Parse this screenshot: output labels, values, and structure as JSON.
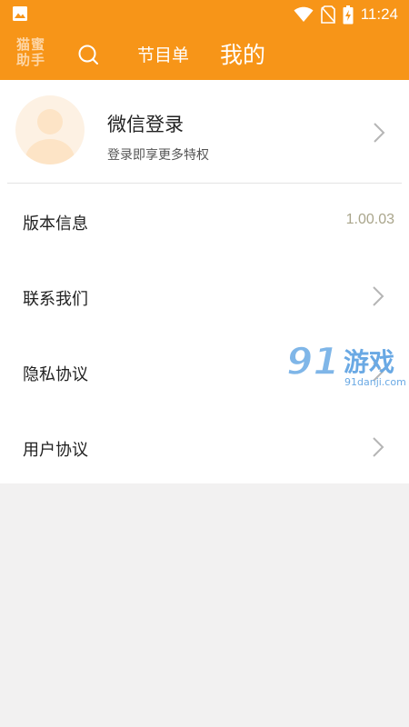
{
  "status_bar": {
    "time": "11:24",
    "icons": [
      "image-notification-icon",
      "wifi-icon",
      "no-sim-icon",
      "battery-charging-icon"
    ]
  },
  "app_bar": {
    "logo_text": [
      "猫蜜",
      "助手"
    ],
    "search_icon": "search-icon",
    "tabs": [
      {
        "label": "节目单",
        "selected": false
      },
      {
        "label": "我的",
        "selected": true
      }
    ]
  },
  "profile": {
    "name": "微信登录",
    "subtitle": "登录即享更多特权",
    "avatar_icon": "user-avatar-icon"
  },
  "menu": {
    "items": [
      {
        "label": "版本信息",
        "value": "1.00.03"
      },
      {
        "label": "联系我们"
      },
      {
        "label": "隐私协议"
      },
      {
        "label": "用户协议"
      }
    ]
  },
  "watermark": {
    "brand": "91游戏",
    "domain": "91danji.com"
  },
  "colors": {
    "primary": "#f79518",
    "background": "#f2f1f1",
    "version_text": "#a9a58b"
  }
}
